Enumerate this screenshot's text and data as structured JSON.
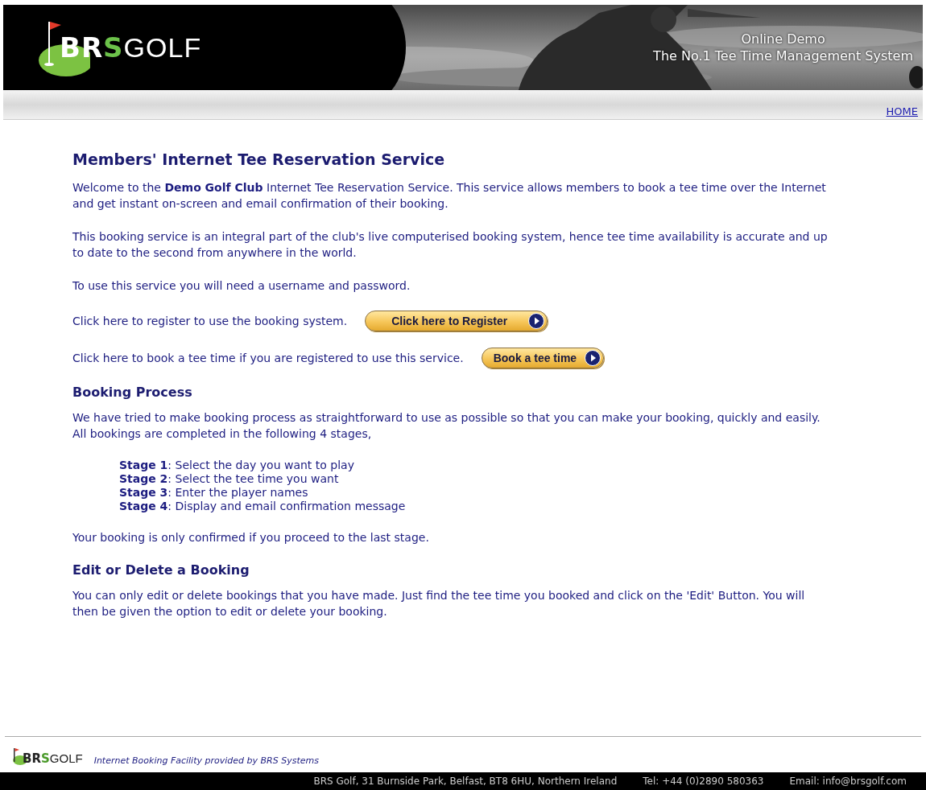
{
  "header": {
    "logo": [
      {
        "text": "BR",
        "kind": "bold"
      },
      {
        "text": "S",
        "kind": "accent"
      },
      {
        "text": "GOLF",
        "kind": "light"
      }
    ],
    "tagline": [
      "Online Demo",
      "The No.1 Tee Time Management System"
    ]
  },
  "nav": {
    "links": [
      "HOME"
    ]
  },
  "content": [
    {
      "kind": "title",
      "text": "Members' Internet Tee Reservation Service"
    },
    {
      "kind": "para",
      "text": "Welcome to the **Demo Golf Club** Internet Tee Reservation Service. This service allows members to book a tee time over the Internet and get instant on-screen and email confirmation of their booking."
    },
    {
      "kind": "para",
      "text": "This booking service is an integral part of the club's live computerised booking system, hence tee time availability is accurate and up to date to the second from anywhere in the world."
    },
    {
      "kind": "para",
      "text": "To use this service you will need a username and password."
    },
    {
      "kind": "action",
      "text": "Click here to register to use the booking system.",
      "button": "Click here to Register"
    },
    {
      "kind": "action",
      "text": "Click here to book a tee time if you are registered to use this service.",
      "button": "Book a tee time"
    },
    {
      "kind": "heading",
      "text": "Booking Process"
    },
    {
      "kind": "para",
      "text": "We have tried to make booking process as straightforward to use as possible so that you can make your booking, quickly and easily. All bookings are completed in the following 4 stages,"
    },
    {
      "kind": "stages",
      "items": [
        "**Stage 1**: Select the day you want to play",
        "**Stage 2**: Select the tee time you want",
        "**Stage 3**: Enter the player names",
        "**Stage 4**: Display and email confirmation message"
      ]
    },
    {
      "kind": "para",
      "text": "Your booking is only confirmed if you proceed to the last stage."
    },
    {
      "kind": "heading",
      "text": "Edit or Delete a Booking"
    },
    {
      "kind": "para",
      "text": "You can only edit or delete bookings that you have made. Just find the tee time you booked and click on the 'Edit' Button. You will then be given the option to edit or delete your booking."
    }
  ],
  "footer": {
    "logo": [
      {
        "text": "BR",
        "kind": "bold"
      },
      {
        "text": "S",
        "kind": "accent"
      },
      {
        "text": "GOLF",
        "kind": "light"
      }
    ],
    "credit": "Internet Booking Facility provided by BRS Systems",
    "contact": [
      "BRS Golf, 31 Burnside Park, Belfast, BT8 6HU, Northern Ireland",
      "Tel: +44 (0)2890 580363",
      "Email: info@brsgolf.com"
    ]
  }
}
